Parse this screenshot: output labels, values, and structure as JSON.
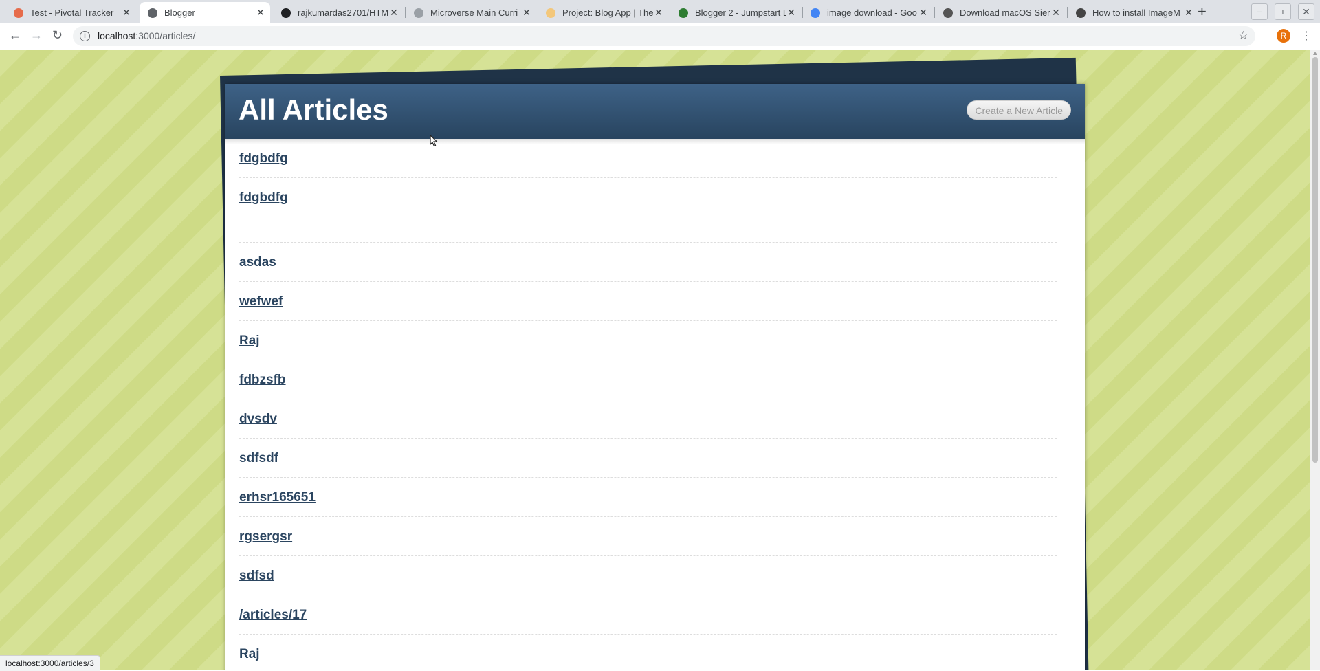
{
  "browser": {
    "tabs": [
      {
        "title": "Test - Pivotal Tracker",
        "icon": "pivotal-tracker-icon",
        "color": "#e66b4a",
        "active": false
      },
      {
        "title": "Blogger",
        "icon": "globe-icon",
        "color": "#5f6368",
        "active": true
      },
      {
        "title": "rajkumardas2701/HTM",
        "icon": "github-icon",
        "color": "#202124",
        "active": false
      },
      {
        "title": "Microverse Main Curri",
        "icon": "microverse-icon",
        "color": "#9aa0a6",
        "active": false
      },
      {
        "title": "Project: Blog App | The",
        "icon": "theodinproject-icon",
        "color": "#f3c77a",
        "active": false
      },
      {
        "title": "Blogger 2 - Jumpstart L",
        "icon": "jumpstart-lab-icon",
        "color": "#2e7d32",
        "active": false
      },
      {
        "title": "image download - Goo",
        "icon": "google-icon",
        "color": "#4285f4",
        "active": false
      },
      {
        "title": "Download macOS Sier",
        "icon": "apple-icon",
        "color": "#555555",
        "active": false
      },
      {
        "title": "How to install ImageM",
        "icon": "linux-icon",
        "color": "#444444",
        "active": false
      }
    ],
    "url_host": "localhost",
    "url_path": ":3000/articles/",
    "profile_initial": "R",
    "status_url": "localhost:3000/articles/3"
  },
  "page": {
    "title": "All Articles",
    "create_label": "Create a New Article",
    "articles": [
      "fdgbdfg",
      "fdgbdfg",
      "",
      "asdas",
      "wefwef",
      "Raj",
      "fdbzsfb",
      "dvsdv",
      "sdfsdf",
      "erhsr165651",
      "rgsergsr",
      "sdfsd",
      "/articles/17",
      "Raj"
    ],
    "colors": {
      "header": "#2e4b69",
      "link": "#2b4560",
      "background": "#d3e08f"
    }
  }
}
